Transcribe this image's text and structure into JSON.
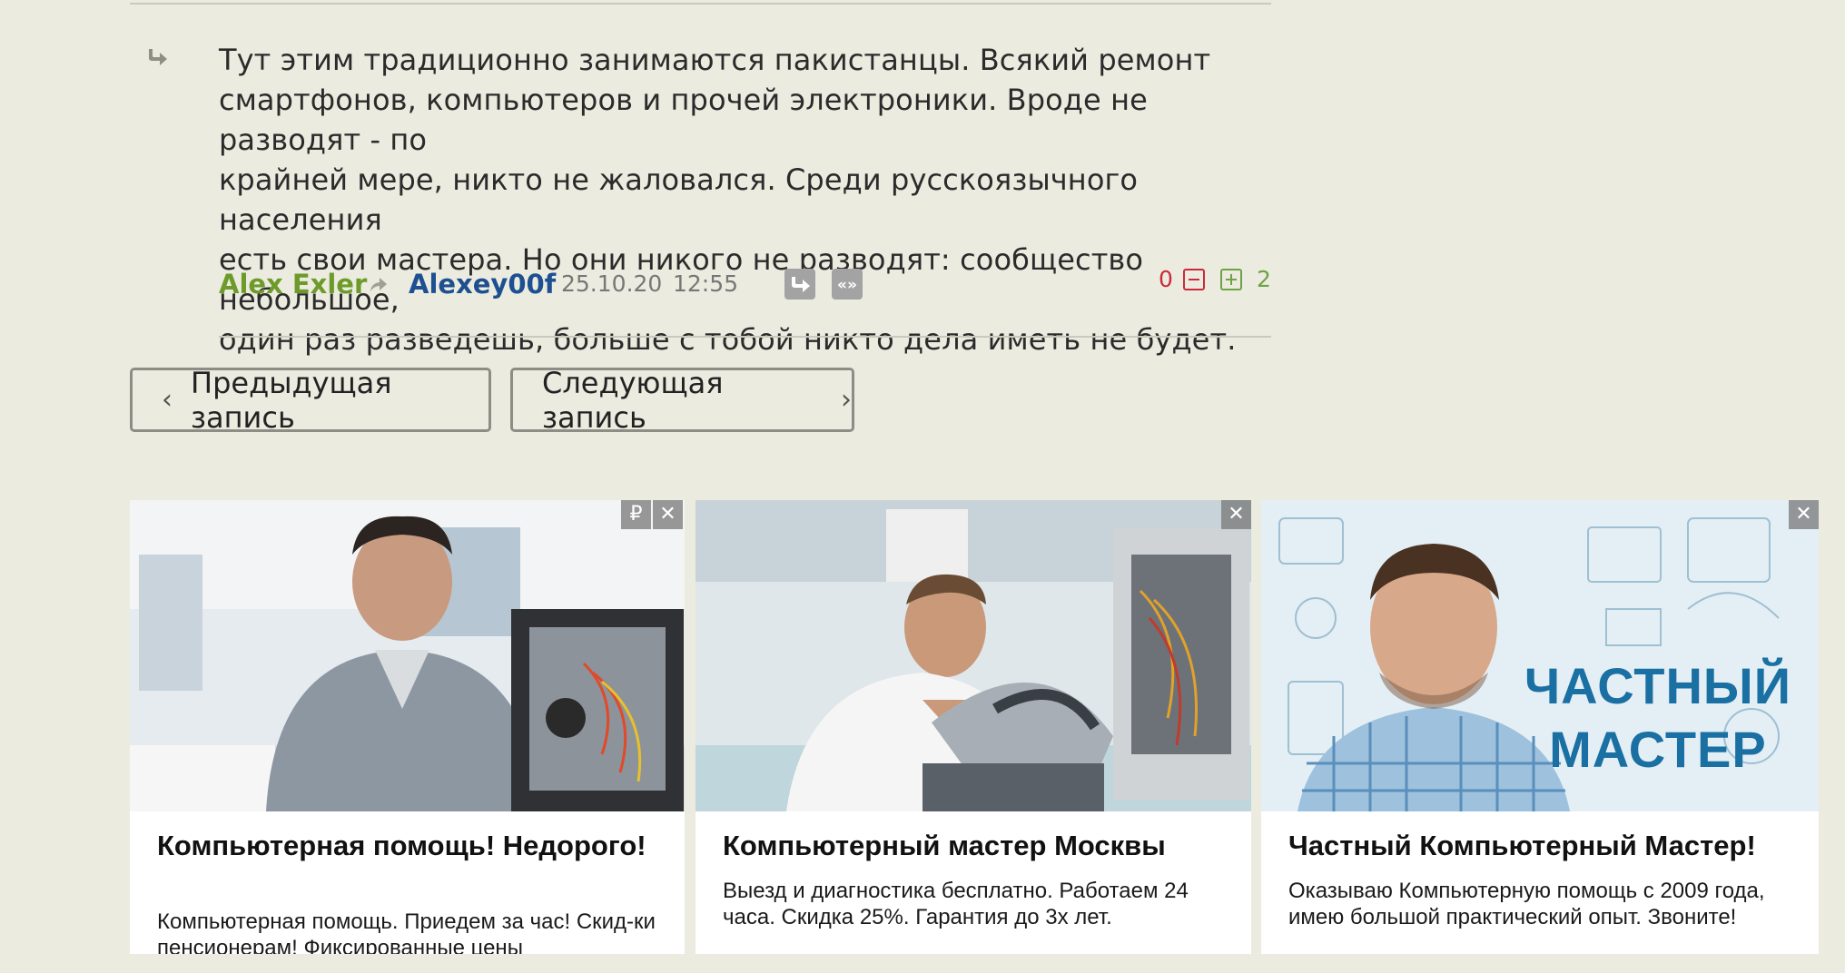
{
  "comment": {
    "text": "Тут этим традиционно занимаются пакистанцы. Всякий ремонт\nсмартфонов, компьютеров и прочей электроники. Вроде не разводят - по\nкрайней мере, никто не жаловался. Среди русскоязычного населения\nесть свои мастера. Но они никого не разводят: сообщество небольшое,\nодин раз разведешь, больше с тобой никто дела иметь не будет.",
    "author": "Alex Exler",
    "recipient": "Alexey00f",
    "date": "25.10.20",
    "time": "12:55",
    "score_negative": "0",
    "score_positive": "2"
  },
  "navigation": {
    "prev_label": "Предыдущая запись",
    "next_label": "Следующая запись",
    "prev_chevron": "‹",
    "next_chevron": "›"
  },
  "ads": [
    {
      "title": "Компьютерная помощь! Недорого!",
      "text": "Компьютерная помощь. Приедем за час! Скид-ки пенсионерам! Фиксированные цены",
      "controls": [
        "₽",
        "✕"
      ]
    },
    {
      "title": "Компьютерный мастер Москвы",
      "text": "Выезд и диагностика бесплатно. Работаем 24 часа. Скидка 25%. Гарантия до 3х лет.",
      "controls": [
        "✕"
      ]
    },
    {
      "title": "Частный Компьютерный Мастер!",
      "text": "Оказываю Компьютерную помощь с 2009 года, имею большой практический опыт. Звоните!",
      "image_headline": "ЧАСТНЫЙ\nМАСТЕР",
      "controls": [
        "✕"
      ]
    }
  ],
  "colors": {
    "background": "#ebebe0",
    "author": "#6e9a2a",
    "recipient": "#1d4f91",
    "negative": "#cc2a3c",
    "positive": "#6ea344"
  },
  "icons": [
    "reply-arrow-icon",
    "share-arrow-icon",
    "reply-icon",
    "quote-icon",
    "minus-icon",
    "plus-icon",
    "chevron-left-icon",
    "chevron-right-icon",
    "ruble-icon",
    "close-icon"
  ]
}
